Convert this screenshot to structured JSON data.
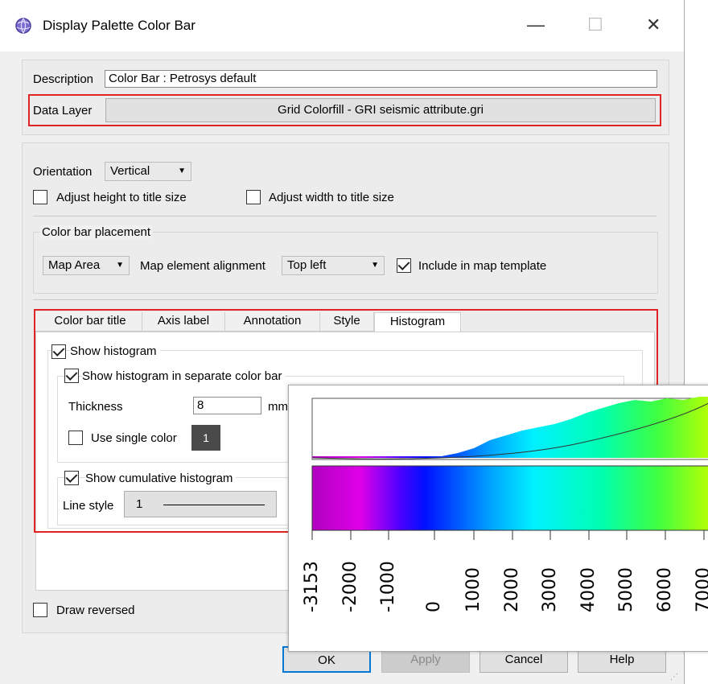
{
  "window": {
    "title": "Display Palette Color Bar",
    "icon": "globe-app-icon",
    "controls": {
      "minimize": "—",
      "maximize": "☐",
      "close": "✕"
    }
  },
  "description": {
    "label": "Description",
    "value": "Color Bar : Petrosys default"
  },
  "data_layer": {
    "label": "Data Layer",
    "value": "Grid Colorfill - GRI seismic attribute.gri"
  },
  "orientation": {
    "label": "Orientation",
    "value": "Vertical"
  },
  "adjust_height": {
    "label": "Adjust height to title size",
    "checked": false
  },
  "adjust_width": {
    "label": "Adjust width to title size",
    "checked": false
  },
  "placement": {
    "legend": "Color bar placement",
    "area": "Map Area",
    "alignment_label": "Map element alignment",
    "alignment_value": "Top left",
    "include_label": "Include in map template",
    "include_checked": true
  },
  "tabs": [
    {
      "label": "Color bar title"
    },
    {
      "label": "Axis label"
    },
    {
      "label": "Annotation"
    },
    {
      "label": "Style"
    },
    {
      "label": "Histogram",
      "active": true
    }
  ],
  "histogram": {
    "show_histogram": "Show histogram",
    "show_separate": "Show histogram in separate color bar",
    "thickness_label": "Thickness",
    "thickness_value": "8",
    "thickness_unit": "mm",
    "single_color_label": "Use single color",
    "single_color_value": "1",
    "show_cumulative": "Show cumulative histogram",
    "line_style_label": "Line style",
    "line_style_value": "1"
  },
  "draw_reversed": {
    "label": "Draw reversed",
    "checked": false
  },
  "buttons": {
    "ok": "OK",
    "apply": "Apply",
    "cancel": "Cancel",
    "help": "Help"
  },
  "preview": {
    "tick_labels": [
      "-3153",
      "-2000",
      "-1000",
      "0",
      "1000",
      "2000",
      "3000",
      "4000",
      "5000",
      "6000",
      "7000"
    ]
  }
}
